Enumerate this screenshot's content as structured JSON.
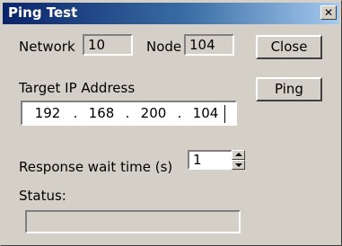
{
  "window": {
    "title": "Ping Test",
    "close_glyph": "✕"
  },
  "network": {
    "label": "Network",
    "value": "10"
  },
  "node": {
    "label": "Node",
    "value": "104"
  },
  "target_ip": {
    "label": "Target IP Address",
    "octets": [
      "192",
      "168",
      "200",
      "104"
    ]
  },
  "response_wait": {
    "label": "Response wait time (s)",
    "value": "1"
  },
  "status": {
    "label": "Status:",
    "value": ""
  },
  "buttons": {
    "close_label": "Close",
    "ping_label": "Ping"
  },
  "colors": {
    "face": "#d4d0c8",
    "title_start": "#0a246a",
    "title_end": "#a6caf0"
  },
  "icons": {
    "spin_up": "arrow-up-icon",
    "spin_down": "arrow-down-icon"
  }
}
